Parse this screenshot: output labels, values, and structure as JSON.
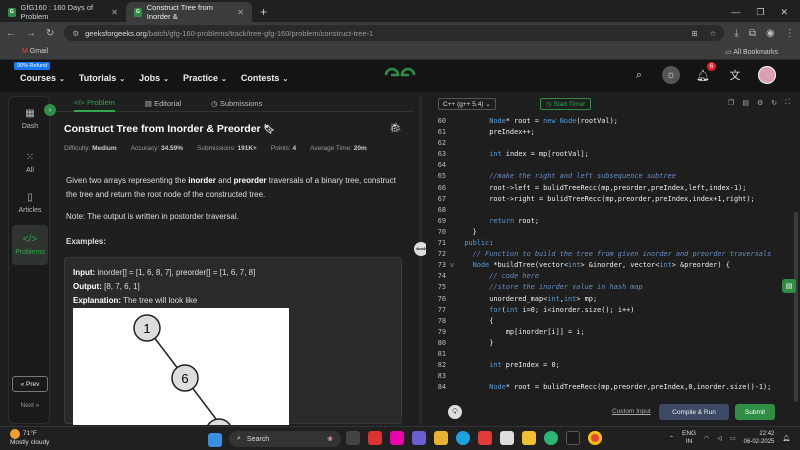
{
  "browser": {
    "tabs": [
      {
        "title": "GfG160 : 160 Days of Problem",
        "active": false
      },
      {
        "title": "Construct Tree from Inorder &",
        "active": true
      }
    ],
    "url_host": "geeksforgeeks.org",
    "url_path": "/batch/gfg-160-problems/track/tree-gfg-160/problem/construct-tree-1",
    "bookmark": "Gmail",
    "all_bookmarks": "All Bookmarks"
  },
  "header": {
    "refund_badge": "90% Refund",
    "menu": [
      "Courses",
      "Tutorials",
      "Jobs",
      "Practice",
      "Contests"
    ],
    "notification_count": "6"
  },
  "sidebar": {
    "items": [
      {
        "label": "Dash",
        "icon": "dashboard-icon"
      },
      {
        "label": "All",
        "icon": "grid-icon"
      },
      {
        "label": "Articles",
        "icon": "book-icon"
      },
      {
        "label": "Problems",
        "icon": "code-icon"
      }
    ],
    "prev": "Prev",
    "next": "Next"
  },
  "problem": {
    "tabs": [
      "Problem",
      "Editorial",
      "Submissions"
    ],
    "title": "Construct Tree from Inorder & Preorder",
    "meta": {
      "difficulty_label": "Difficulty:",
      "difficulty": "Medium",
      "accuracy_label": "Accuracy:",
      "accuracy": "34.59%",
      "submissions_label": "Submissions:",
      "submissions": "191K+",
      "points_label": "Points:",
      "points": "4",
      "time_label": "Average Time:",
      "time": "20m"
    },
    "desc_1": "Given two arrays representing the ",
    "desc_inorder": "inorder",
    "desc_2": " and ",
    "desc_preorder": "preorder",
    "desc_3": " traversals of a binary tree, construct the tree and return the root node of the constructed tree.",
    "note": "Note: The output is written in postorder traversal.",
    "examples_heading": "Examples:",
    "example": {
      "input_label": "Input:",
      "input": "inorder[] = [1, 6, 8, 7], preorder[] = [1, 6, 7, 8]",
      "output_label": "Output:",
      "output": "[8, 7, 6, 1]",
      "explanation_label": "Explanation:",
      "explanation": "The tree will look like",
      "tree_nodes": [
        "1",
        "6",
        "7"
      ]
    }
  },
  "editor": {
    "language": "C++ (g++ 5.4)",
    "timer": "Start Timer",
    "lines": [
      {
        "n": "60",
        "code": "        Node* root = new Node(rootVal);"
      },
      {
        "n": "61",
        "code": "        preIndex++;"
      },
      {
        "n": "62",
        "code": ""
      },
      {
        "n": "63",
        "code": "        int index = mp[rootVal];"
      },
      {
        "n": "64",
        "code": ""
      },
      {
        "n": "65",
        "code": "        //make the right and left subsequence subtree",
        "comment": true
      },
      {
        "n": "66",
        "code": "        root->left = bulidTreeRecc(mp,preorder,preIndex,left,index-1);"
      },
      {
        "n": "67",
        "code": "        root->right = bulidTreeRecc(mp,preorder,preIndex,index+1,right);"
      },
      {
        "n": "68",
        "code": ""
      },
      {
        "n": "69",
        "code": "        return root;"
      },
      {
        "n": "70",
        "code": "    }"
      },
      {
        "n": "71",
        "code": "  public:"
      },
      {
        "n": "72",
        "code": "    // Function to build the tree from given inorder and preorder traversals",
        "comment": true
      },
      {
        "n": "73",
        "code": "    Node *buildTree(vector<int> &inorder, vector<int> &preorder) {",
        "fold": "v"
      },
      {
        "n": "74",
        "code": "        // code here",
        "comment": true
      },
      {
        "n": "75",
        "code": "        //store the inorder value in hash map",
        "comment": true
      },
      {
        "n": "76",
        "code": "        unordered_map<int,int> mp;"
      },
      {
        "n": "77",
        "code": "        for(int i=0; i<inorder.size(); i++)"
      },
      {
        "n": "78",
        "code": "        {"
      },
      {
        "n": "79",
        "code": "            mp[inorder[i]] = i;"
      },
      {
        "n": "80",
        "code": "        }"
      },
      {
        "n": "81",
        "code": ""
      },
      {
        "n": "82",
        "code": "        int preIndex = 0;"
      },
      {
        "n": "83",
        "code": ""
      },
      {
        "n": "84",
        "code": "        Node* root = bulidTreeRecc(mp,preorder,preIndex,0,inorder.size()-1);"
      },
      {
        "n": "85",
        "code": "        return root;"
      },
      {
        "n": "86",
        "code": "    }"
      },
      {
        "n": "87",
        "code": "};"
      },
      {
        "n": "88",
        "code": "// } Driver Code Ends",
        "comment": true,
        "fold": ">",
        "highlight": true
      }
    ],
    "custom_input": "Custom Input",
    "compile_run": "Compile & Run",
    "submit": "Submit"
  },
  "taskbar": {
    "temp": "71°F",
    "weather": "Mostly cloudy",
    "search_placeholder": "Search",
    "lang_1": "ENG",
    "lang_2": "IN",
    "time": "22:42",
    "date": "06-02-2025"
  }
}
